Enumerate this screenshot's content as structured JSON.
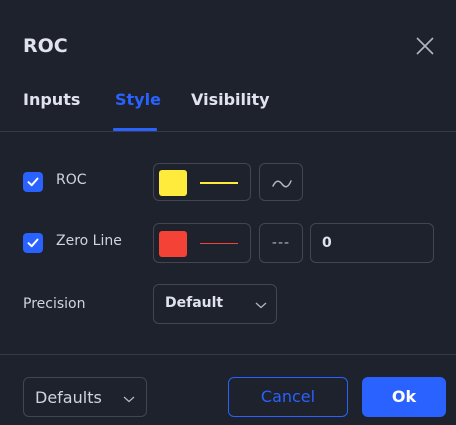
{
  "dialog": {
    "title": "ROC",
    "tabs": [
      {
        "label": "Inputs",
        "active": false
      },
      {
        "label": "Style",
        "active": true
      },
      {
        "label": "Visibility",
        "active": false
      }
    ]
  },
  "style": {
    "roc": {
      "label": "ROC",
      "checked": true,
      "color": "#ffeb3b",
      "line_style": "solid",
      "plot_type_icon": "line-plot-icon"
    },
    "zero_line": {
      "label": "Zero Line",
      "checked": true,
      "color": "#f44336",
      "line_style": "dashed",
      "line_style_label": "---",
      "value": "0"
    },
    "precision": {
      "label": "Precision",
      "value": "Default"
    }
  },
  "footer": {
    "defaults_label": "Defaults",
    "cancel_label": "Cancel",
    "ok_label": "Ok"
  },
  "colors": {
    "background": "#1e222d",
    "accent": "#2962ff",
    "border": "#434651",
    "text": "#d1d4dc"
  }
}
